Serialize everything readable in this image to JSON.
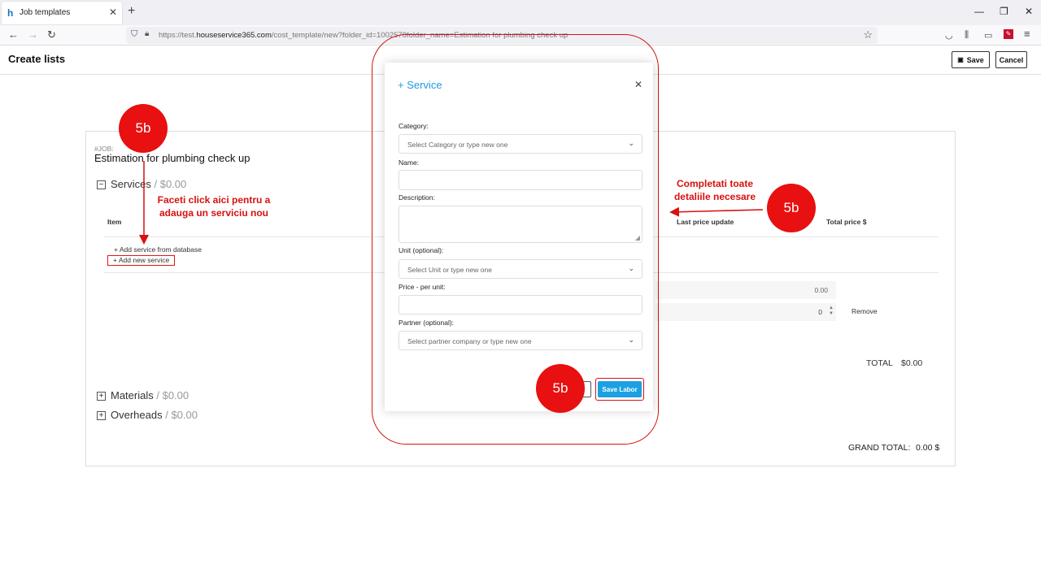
{
  "browser": {
    "tab_title": "Job templates",
    "url_prefix": "https://test.",
    "url_host": "houseservice365.com",
    "url_rest": "/cost_template/new?folder_id=1002578folder_name=Estimation for plumbing check up"
  },
  "header": {
    "page_title": "Create lists",
    "save_label": "Save",
    "cancel_label": "Cancel"
  },
  "card": {
    "job_tag": "#JOB:",
    "job_title": "Estimation for plumbing check up",
    "services_title": "Services",
    "services_amount": "/ $0.00",
    "col_item": "Item",
    "col_last_price": "Last price update",
    "col_total_price": "Total price $",
    "add_from_db": "Add service from database",
    "add_new": "Add new service",
    "price_value": "0.00",
    "qty_value": "0",
    "remove_label": "Remove",
    "total_label": "TOTAL",
    "total_value": "$0.00",
    "materials_title": "Materials",
    "materials_amount": "/ $0.00",
    "overheads_title": "Overheads",
    "overheads_amount": "/ $0.00",
    "grand_total_label": "GRAND TOTAL:",
    "grand_total_value": "0.00 $"
  },
  "modal": {
    "title": "+ Service",
    "category_label": "Category:",
    "category_placeholder": "Select Category or type new one",
    "name_label": "Name:",
    "description_label": "Description:",
    "unit_label": "Unit (optional):",
    "unit_placeholder": "Select Unit or type new one",
    "price_label": "Price - per unit:",
    "partner_label": "Partner (optional):",
    "partner_placeholder": "Select partner company or type new one",
    "save_label": "Save Labor"
  },
  "annotations": {
    "step": "5b",
    "note_left": "Faceti click aici pentru a adauga un serviciu nou",
    "note_right": "Completati toate detaliile necesare"
  },
  "colors": {
    "accent": "#1ba1e2",
    "annotation": "#e81010"
  }
}
